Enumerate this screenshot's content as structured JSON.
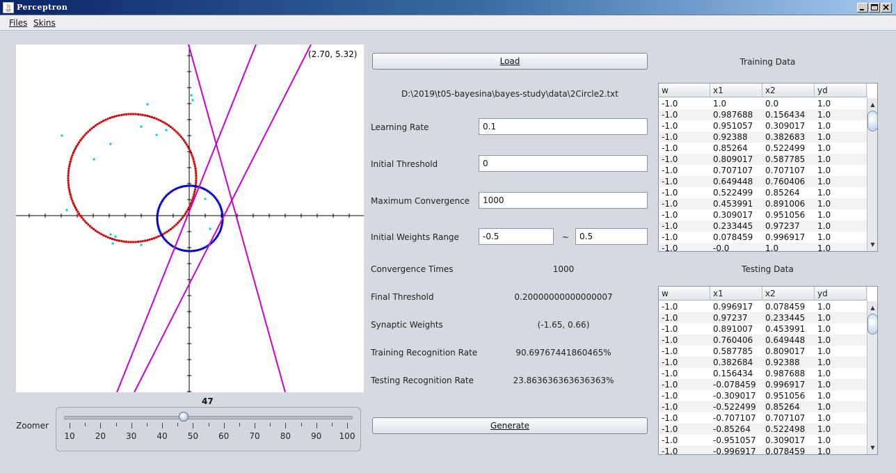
{
  "window": {
    "title": "Perceptron"
  },
  "menu": [
    "Files",
    "Skins"
  ],
  "plot": {
    "coord": "(2.70, 5.32)"
  },
  "buttons": {
    "load": "Load",
    "generate": "Generate"
  },
  "file_path": "D:\\2019\\t05-bayesina\\bayes-study\\data\\2Circle2.txt",
  "params": {
    "learning_rate": {
      "label": "Learning Rate",
      "value": "0.1"
    },
    "initial_threshold": {
      "label": "Initial Threshold",
      "value": "0"
    },
    "max_convergence": {
      "label": "Maximum Convergence",
      "value": "1000"
    },
    "weights_range": {
      "label": "Initial Weights Range",
      "min": "-0.5",
      "sep": "~",
      "max": "0.5"
    }
  },
  "results": {
    "convergence_times": {
      "label": "Convergence Times",
      "value": "1000"
    },
    "final_threshold": {
      "label": "Final Threshold",
      "value": "0.20000000000000007"
    },
    "synaptic_weights": {
      "label": "Synaptic Weights",
      "value": "(-1.65, 0.66)"
    },
    "training_rate": {
      "label": "Training Recognition Rate",
      "value": "90.69767441860465%"
    },
    "testing_rate": {
      "label": "Testing Recognition Rate",
      "value": "23.863636363636363%"
    }
  },
  "zoomer": {
    "label": "Zoomer",
    "value": "47",
    "min": 10,
    "max": 100,
    "level": 47,
    "ticks": [
      "10",
      "20",
      "30",
      "40",
      "50",
      "60",
      "70",
      "80",
      "90",
      "100"
    ]
  },
  "training": {
    "title": "Training Data",
    "columns": [
      "w",
      "x1",
      "x2",
      "yd"
    ],
    "rows": [
      [
        "-1.0",
        "1.0",
        "0.0",
        "1.0"
      ],
      [
        "-1.0",
        "0.987688",
        "0.156434",
        "1.0"
      ],
      [
        "-1.0",
        "0.951057",
        "0.309017",
        "1.0"
      ],
      [
        "-1.0",
        "0.92388",
        "0.382683",
        "1.0"
      ],
      [
        "-1.0",
        "0.85264",
        "0.522499",
        "1.0"
      ],
      [
        "-1.0",
        "0.809017",
        "0.587785",
        "1.0"
      ],
      [
        "-1.0",
        "0.707107",
        "0.707107",
        "1.0"
      ],
      [
        "-1.0",
        "0.649448",
        "0.760406",
        "1.0"
      ],
      [
        "-1.0",
        "0.522499",
        "0.85264",
        "1.0"
      ],
      [
        "-1.0",
        "0.453991",
        "0.891006",
        "1.0"
      ],
      [
        "-1.0",
        "0.309017",
        "0.951056",
        "1.0"
      ],
      [
        "-1.0",
        "0.233445",
        "0.97237",
        "1.0"
      ],
      [
        "-1.0",
        "0.078459",
        "0.996917",
        "1.0"
      ],
      [
        "-1.0",
        "-0.0",
        "1.0",
        "1.0"
      ]
    ]
  },
  "testing": {
    "title": "Testing Data",
    "columns": [
      "w",
      "x1",
      "x2",
      "yd"
    ],
    "rows": [
      [
        "-1.0",
        "0.996917",
        "0.078459",
        "1.0"
      ],
      [
        "-1.0",
        "0.97237",
        "0.233445",
        "1.0"
      ],
      [
        "-1.0",
        "0.891007",
        "0.453991",
        "1.0"
      ],
      [
        "-1.0",
        "0.760406",
        "0.649448",
        "1.0"
      ],
      [
        "-1.0",
        "0.587785",
        "0.809017",
        "1.0"
      ],
      [
        "-1.0",
        "0.382684",
        "0.92388",
        "1.0"
      ],
      [
        "-1.0",
        "0.156434",
        "0.987688",
        "1.0"
      ],
      [
        "-1.0",
        "-0.078459",
        "0.996917",
        "1.0"
      ],
      [
        "-1.0",
        "-0.309017",
        "0.951056",
        "1.0"
      ],
      [
        "-1.0",
        "-0.522499",
        "0.85264",
        "1.0"
      ],
      [
        "-1.0",
        "-0.707107",
        "0.707107",
        "1.0"
      ],
      [
        "-1.0",
        "-0.85264",
        "0.522498",
        "1.0"
      ],
      [
        "-1.0",
        "-0.951057",
        "0.309017",
        "1.0"
      ],
      [
        "-1.0",
        "-0.996917",
        "0.078459",
        "1.0"
      ]
    ]
  },
  "colors": {
    "class1": "#cc0000",
    "class2": "#0000cc",
    "boundary": "#cc00cc",
    "test_points": "#00cccc"
  }
}
